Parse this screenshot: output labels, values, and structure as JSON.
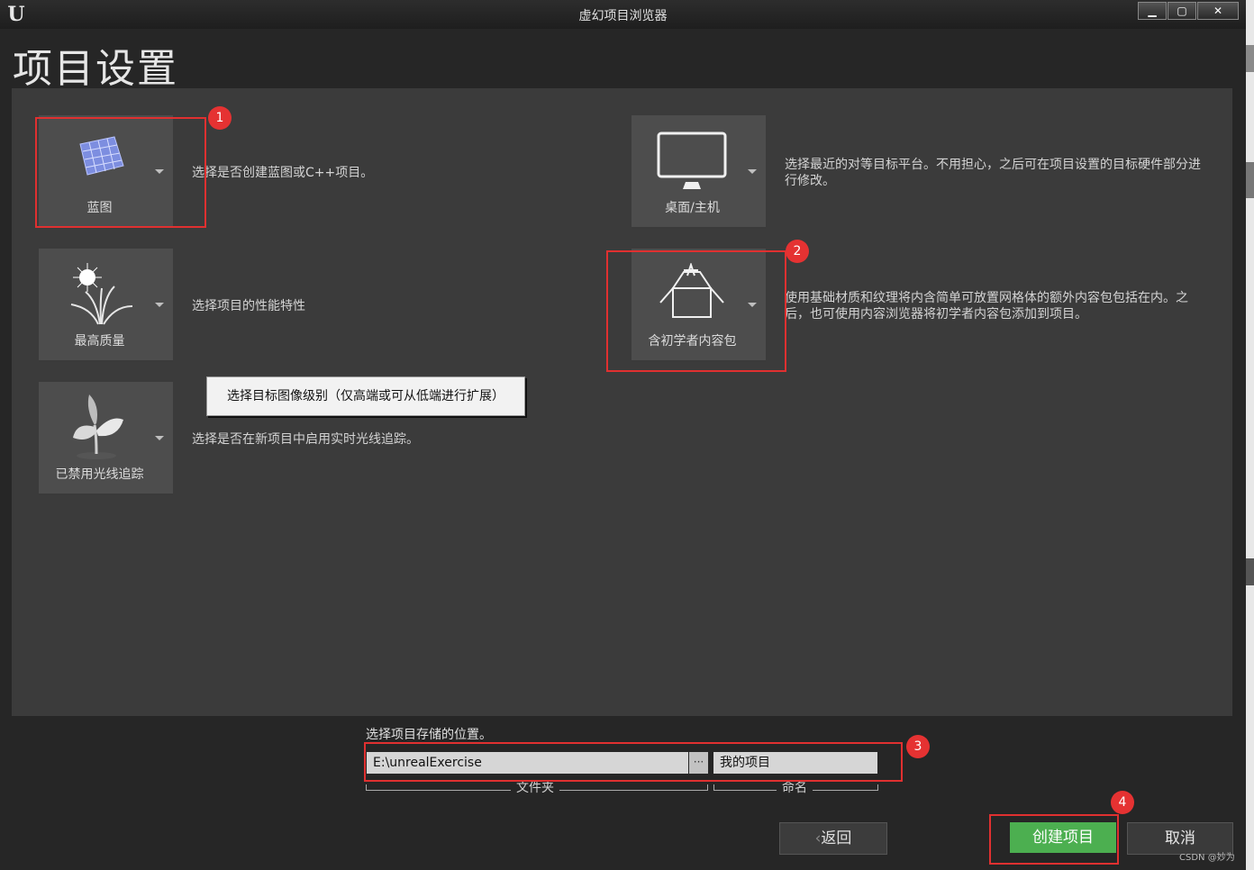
{
  "window": {
    "title": "虚幻项目浏览器",
    "logo": "U",
    "controls": [
      "minimize-icon",
      "maximize-icon",
      "close-icon"
    ]
  },
  "page": {
    "title": "项目设置"
  },
  "settings": {
    "blueprint": {
      "label": "蓝图",
      "description": "选择是否创建蓝图或C++项目。",
      "icon": "blueprint-icon"
    },
    "quality": {
      "label": "最高质量",
      "description": "选择项目的性能特性",
      "icon": "quality-plant-icon"
    },
    "raytracing": {
      "label": "已禁用光线追踪",
      "description": "选择是否在新项目中启用实时光线追踪。",
      "icon": "sprout-icon"
    },
    "platform": {
      "label": "桌面/主机",
      "description": "选择最近的对等目标平台。不用担心，之后可在项目设置的目标硬件部分进行修改。",
      "icon": "monitor-icon"
    },
    "starter": {
      "label": "含初学者内容包",
      "description": "使用基础材质和纹理将内含简单可放置网格体的额外内容包包括在内。之后，也可使用内容浏览器将初学者内容包添加到项目。",
      "icon": "starter-box-icon"
    }
  },
  "tooltip": {
    "text": "选择目标图像级别（仅高端或可从低端进行扩展）"
  },
  "location": {
    "label": "选择项目存储的位置。",
    "folder_value": "E:\\unrealExercise",
    "browse": "···",
    "name_value": "我的项目",
    "folder_caption": "文件夹",
    "name_caption": "命名"
  },
  "buttons": {
    "back": "返回",
    "back_icon": "‹",
    "create": "创建项目",
    "cancel": "取消"
  },
  "annotations": [
    "1",
    "2",
    "3",
    "4"
  ],
  "watermark": "CSDN @妙为",
  "colors": {
    "accent_green": "#4caf50",
    "annotation_red": "#e03030"
  }
}
